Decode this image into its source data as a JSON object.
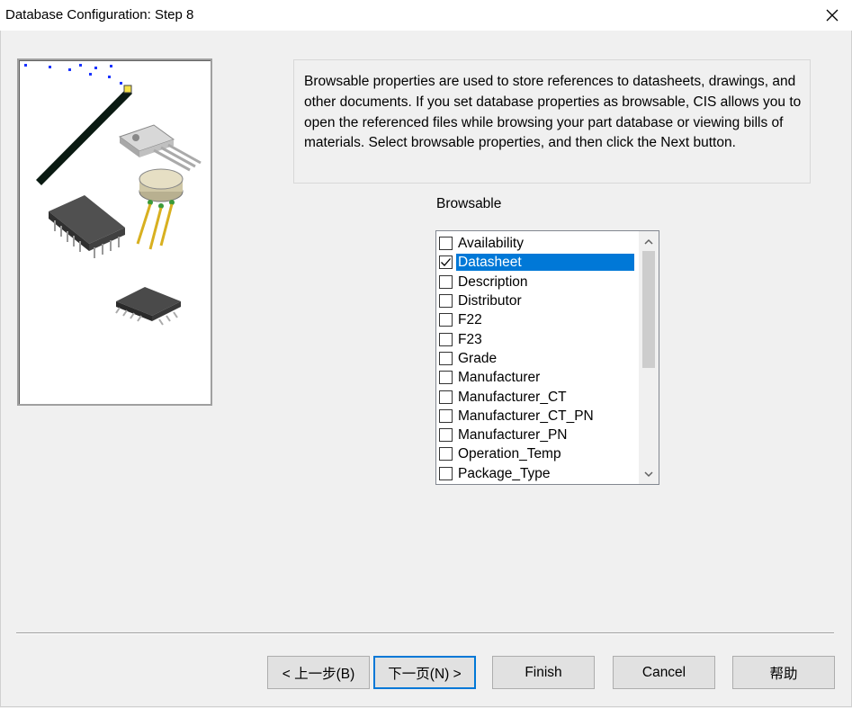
{
  "window": {
    "title": "Database Configuration: Step 8"
  },
  "info": {
    "text": "Browsable properties are used to store references to datasheets, drawings, and other documents. If you set database properties as browsable, CIS allows you to open the referenced files while browsing your part database or viewing bills of materials. Select browsable properties, and then click the Next button."
  },
  "browsable": {
    "label": "Browsable",
    "items": [
      {
        "label": "Availability",
        "checked": false
      },
      {
        "label": "Datasheet",
        "checked": true,
        "selected": true
      },
      {
        "label": "Description",
        "checked": false
      },
      {
        "label": "Distributor",
        "checked": false
      },
      {
        "label": "F22",
        "checked": false
      },
      {
        "label": "F23",
        "checked": false
      },
      {
        "label": "Grade",
        "checked": false
      },
      {
        "label": "Manufacturer",
        "checked": false
      },
      {
        "label": "Manufacturer_CT",
        "checked": false
      },
      {
        "label": "Manufacturer_CT_PN",
        "checked": false
      },
      {
        "label": "Manufacturer_PN",
        "checked": false
      },
      {
        "label": "Operation_Temp",
        "checked": false
      },
      {
        "label": "Package_Type",
        "checked": false
      }
    ]
  },
  "buttons": {
    "back_label": "< 上一步(B)",
    "next_label": "下一页(N) >",
    "finish_label": "Finish",
    "cancel_label": "Cancel",
    "help_label": "帮助"
  },
  "colors": {
    "selection": "#0078d7",
    "dialog_bg": "#f0f0f0"
  }
}
